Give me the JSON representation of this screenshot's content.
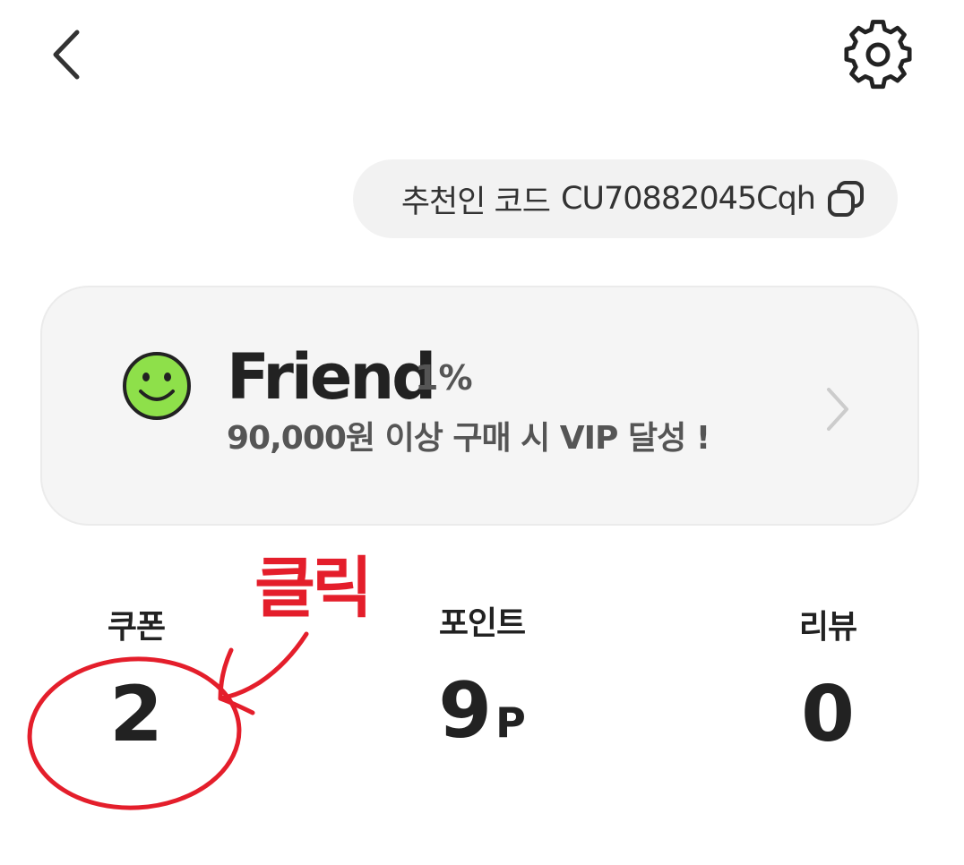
{
  "header": {
    "back_icon": "chevron-left-icon",
    "settings_icon": "gear-icon"
  },
  "referral": {
    "label": "추천인 코드",
    "code": "CU70882045Cqh",
    "copy_icon": "copy-icon"
  },
  "tier": {
    "icon": "smiley-icon",
    "icon_color": "#8ee04a",
    "name": "Friend",
    "rate": "1%",
    "description": "90,000원 이상 구매 시 VIP 달성 !",
    "arrow_icon": "chevron-right-icon"
  },
  "stats": {
    "coupon": {
      "label": "쿠폰",
      "value": "2"
    },
    "point": {
      "label": "포인트",
      "value": "9",
      "unit": "P"
    },
    "review": {
      "label": "리뷰",
      "value": "0"
    }
  },
  "annotation": {
    "text": "클릭",
    "color": "#e41e2b"
  }
}
